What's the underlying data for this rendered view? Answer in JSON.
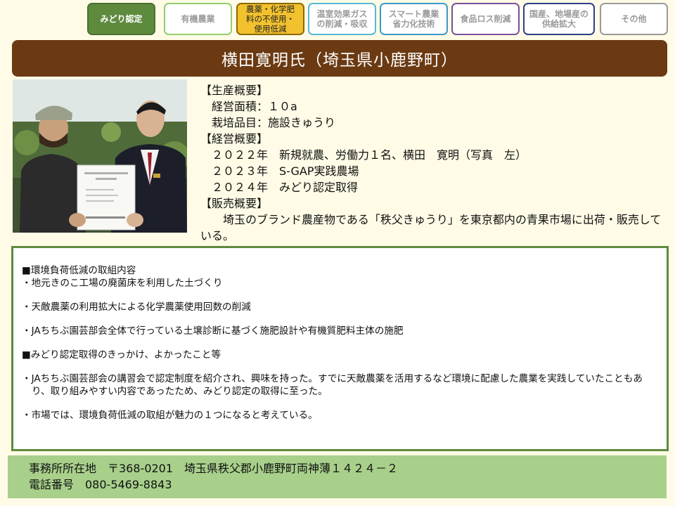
{
  "tabs": [
    {
      "label": "みどり認定",
      "active": true
    },
    {
      "label": "有機農業",
      "active": false
    },
    {
      "label": "農薬・化学肥\n料の不使用・\n使用低減",
      "active": false
    },
    {
      "label": "温室効果ガス\nの削減・吸収",
      "active": false
    },
    {
      "label": "スマート農業\n省力化技術",
      "active": false
    },
    {
      "label": "食品ロス削減",
      "active": false
    },
    {
      "label": "国産、地場産の\n供給拡大",
      "active": false
    },
    {
      "label": "その他",
      "active": false
    }
  ],
  "colors": {
    "tab_midori": "#5e8a3e",
    "tab_organic": "#8fce6f",
    "tab_pesticide_fill": "#f2c12e",
    "tab_pesticide_border": "#8a6a00",
    "tab_ghg": "#55b8d8",
    "tab_smart": "#3b9bc9",
    "tab_foodloss": "#7b4f9e",
    "tab_local": "#2d3f8a",
    "tab_other": "#9a9a9a",
    "title_bar": "#6b3a12",
    "content_border": "#5e8a3e",
    "footer_bg": "#a8d08b"
  },
  "title": "横田寛明氏（埼玉県小鹿野町）",
  "production": {
    "heading": "【生産概要】",
    "area": "　経営面積：１０a",
    "crop": "　栽培品目：施設きゅうり"
  },
  "management": {
    "heading": "【経営概要】",
    "items": [
      "　２０２２年　新規就農、労働力１名、横田　寛明（写真　左）",
      "　２０２３年　S-GAP実践農場",
      "　２０２４年　みどり認定取得"
    ]
  },
  "sales": {
    "heading": "【販売概要】",
    "text": "　　埼玉のブランド農産物である「秩父きゅうり」を東京都内の青果市場に出荷・販売している。"
  },
  "content": {
    "section1_heading": "■環境負荷低減の取組内容",
    "section1_items": [
      "・地元きのこ工場の廃菌床を利用した土づくり",
      "・天敵農薬の利用拡大による化学農薬使用回数の削減",
      "・JAちちぶ園芸部会全体で行っている土壌診断に基づく施肥設計や有機質肥料主体の施肥"
    ],
    "section2_heading": "■みどり認定取得のきっかけ、よかったこと等",
    "section2_items": [
      "・JAちちぶ園芸部会の講習会で認定制度を紹介され、興味を持った。すでに天敵農薬を活用するなど環境に配慮した農業を実践していたこともあり、取り組みやすい内容であったため、みどり認定の取得に至った。",
      "・市場では、環境負荷低減の取組が魅力の１つになると考えている。"
    ]
  },
  "footer": {
    "address": "事務所所在地　〒368-0201　埼玉県秩父郡小鹿野町両神薄１４２４－２",
    "phone": "電話番号　080-5469-8843"
  }
}
